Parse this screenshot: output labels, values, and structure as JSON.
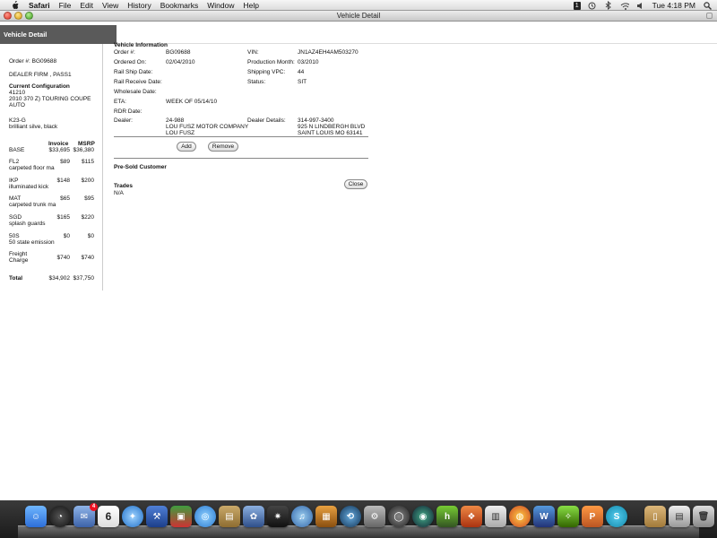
{
  "menubar": {
    "app_name": "Safari",
    "items": [
      "File",
      "Edit",
      "View",
      "History",
      "Bookmarks",
      "Window",
      "Help"
    ],
    "clock": "Tue 4:18 PM",
    "badge": "1"
  },
  "window": {
    "title": "Vehicle Detail"
  },
  "tab": {
    "label": "Vehicle Detail"
  },
  "sidebar": {
    "order_line": "Order #:  BG09688",
    "dealer_line": "DEALER FIRM , PASS1",
    "config_heading": "Current Configuration",
    "config_code": "41210",
    "config_model": "2010 370 Z) TOURING COUPE",
    "config_trans": "AUTO",
    "color_code": "K23-G",
    "color_name": "brilliant silve, black",
    "invoice_header": "Invoice",
    "msrp_header": "MSRP",
    "rows": [
      {
        "code": "BASE",
        "desc": "",
        "invoice": "$33,695",
        "msrp": "$36,380"
      },
      {
        "code": "FL2",
        "desc": "carpeted floor ma",
        "invoice": "$89",
        "msrp": "$115"
      },
      {
        "code": "IKP",
        "desc": "illuminated kick",
        "invoice": "$148",
        "msrp": "$200"
      },
      {
        "code": "MAT",
        "desc": "carpeted trunk ma",
        "invoice": "$65",
        "msrp": "$95"
      },
      {
        "code": "SGD",
        "desc": "splash guards",
        "invoice": "$165",
        "msrp": "$220"
      },
      {
        "code": "50S",
        "desc": "50 state emission",
        "invoice": "$0",
        "msrp": "$0"
      },
      {
        "code": "Freight",
        "desc": "Charge",
        "invoice": "$740",
        "msrp": "$740"
      }
    ],
    "total_label": "Total",
    "total_invoice": "$34,902",
    "total_msrp": "$37,750"
  },
  "vehicle_info": {
    "heading": "Vehicle Information",
    "order_label": "Order #:",
    "order_value": "BG09688",
    "ordered_label": "Ordered On:",
    "ordered_value": "02/04/2010",
    "rail_ship_label": "Rail Ship Date:",
    "rail_ship_value": "",
    "rail_receive_label": "Rail Receive Date:",
    "rail_receive_value": "",
    "wholesale_label": "Wholesale Date:",
    "wholesale_value": "",
    "eta_label": "ETA:",
    "eta_value": "WEEK OF 05/14/10",
    "rdr_label": "RDR Date:",
    "rdr_value": "",
    "dealer_label": "Dealer:",
    "dealer_code": "24-988",
    "dealer_name": "LOU FUSZ MOTOR COMPANY",
    "dealer_contact": "LOU FUSZ",
    "vin_label": "VIN:",
    "vin_value": "JN1AZ4EH4AM503270",
    "prod_month_label": "Production Month:",
    "prod_month_value": "03/2010",
    "shipping_label": "Shipping VPC:",
    "shipping_value": "44",
    "status_label": "Status:",
    "status_value": "SIT",
    "dealer_details_label": "Dealer Details:",
    "dealer_phone": "314-997-3400",
    "dealer_address": "925 N LINDBERGH BLVD",
    "dealer_city": "SAINT LOUIS MO  63141"
  },
  "presold": {
    "label": "Pre-Sold Customer",
    "add_label": "Add",
    "remove_label": "Remove"
  },
  "trades": {
    "heading": "Trades",
    "value": "N/A",
    "close_label": "Close"
  },
  "dock": {
    "icons": [
      "finder-icon",
      "dashboard-icon",
      "mail-stamp-icon",
      "ical-icon",
      "safari-icon",
      "xcode-icon",
      "photo-booth-icon",
      "ichat-icon",
      "preview-icon",
      "iphoto-icon",
      "aperture-icon",
      "itunes-icon",
      "photo-icon",
      "time-machine-icon",
      "system-preferences-icon",
      "rubber-band-icon",
      "comic-icon",
      "h-app-icon",
      "colored-app-icon",
      "app-store-icon",
      "firefox-icon",
      "w-app-icon",
      "dragon-icon",
      "p-app-icon",
      "skype-icon",
      "documents-folder-icon",
      "downloads-folder-icon",
      "trash-icon"
    ],
    "ical_day": "6",
    "mail_badge": "4"
  }
}
